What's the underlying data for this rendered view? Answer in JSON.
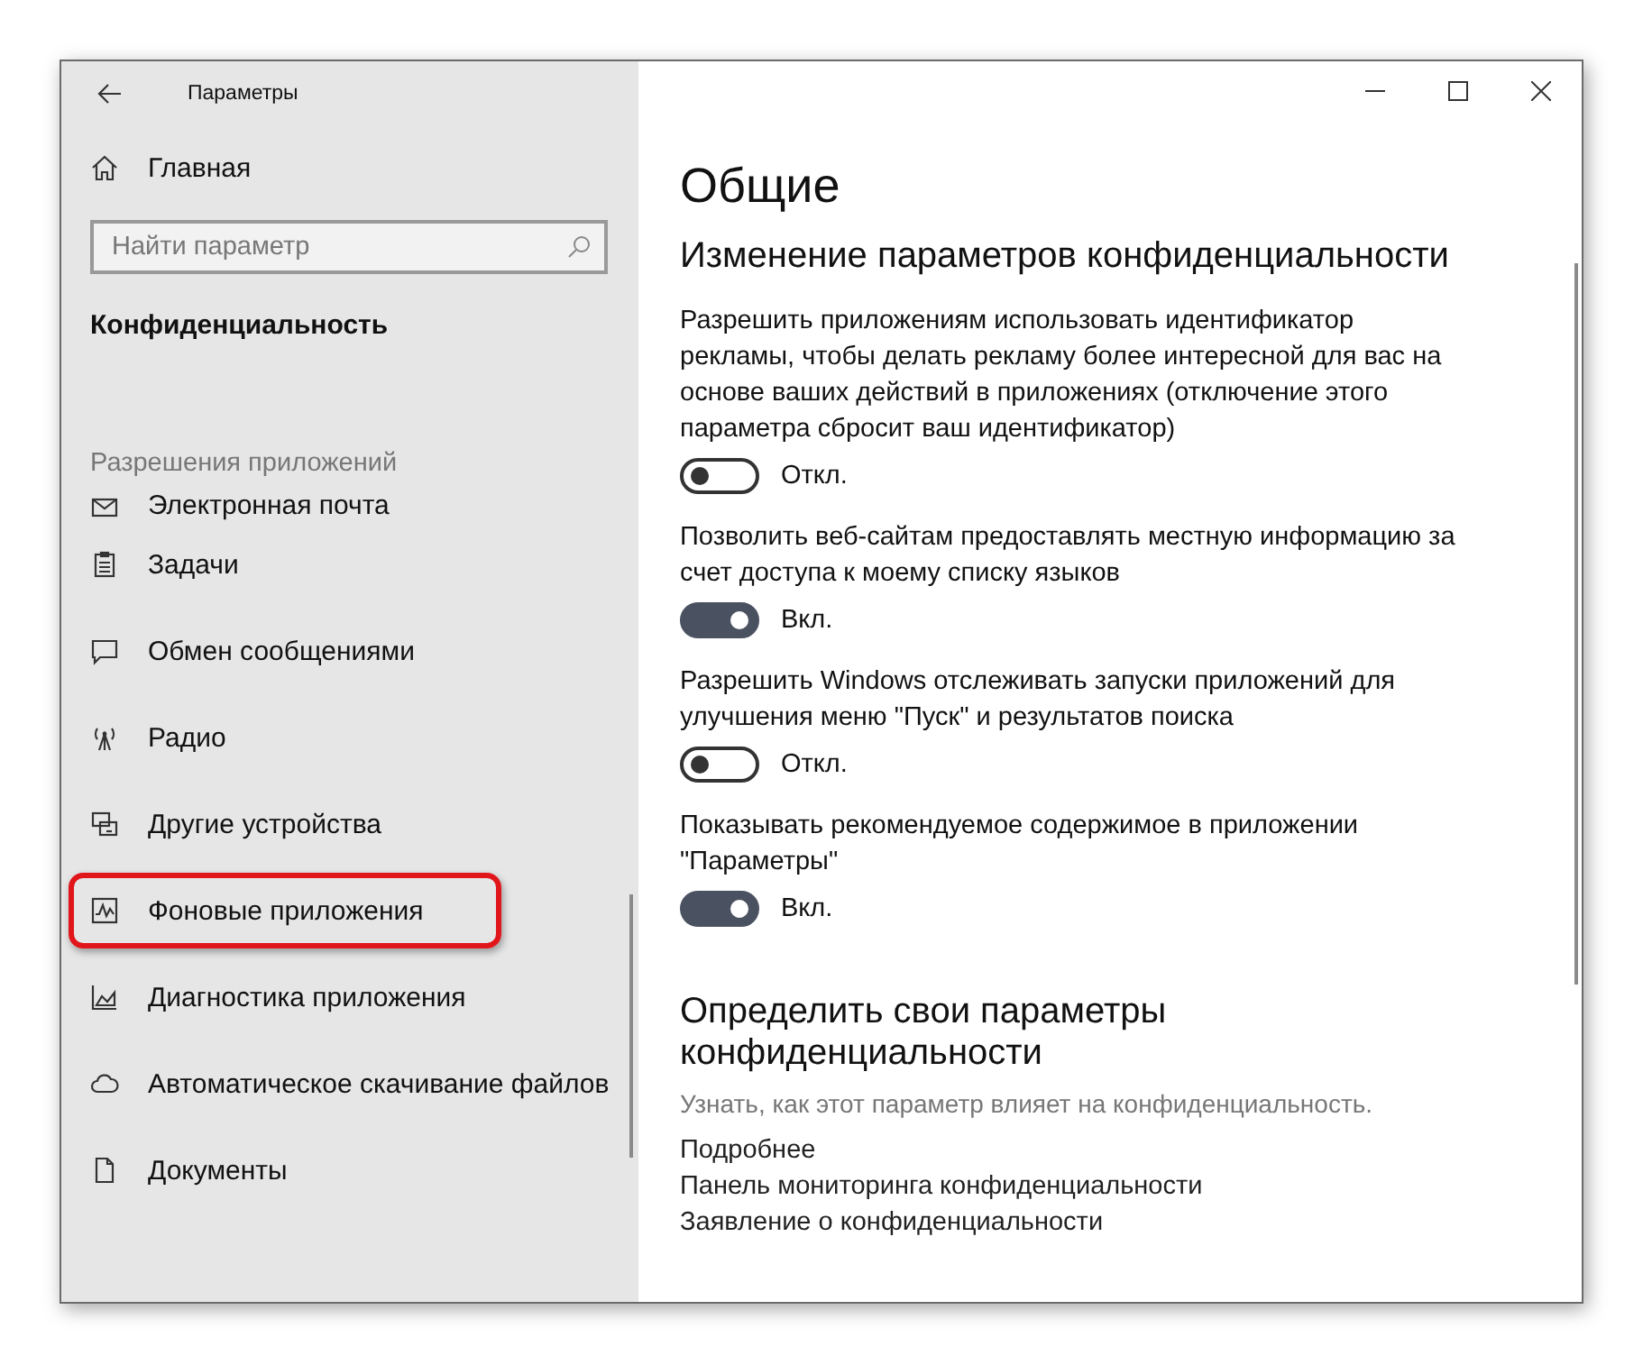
{
  "window": {
    "title": "Параметры"
  },
  "sidebar": {
    "home": "Главная",
    "search": {
      "placeholder": "Найти параметр"
    },
    "section": "Конфиденциальность",
    "group": "Разрешения приложений",
    "items": [
      {
        "label": "Электронная почта",
        "kind": "mail",
        "highlighted": false
      },
      {
        "label": "Задачи",
        "kind": "tasks",
        "highlighted": false
      },
      {
        "label": "Обмен сообщениями",
        "kind": "chat",
        "highlighted": false
      },
      {
        "label": "Радио",
        "kind": "radio",
        "highlighted": false
      },
      {
        "label": "Другие устройства",
        "kind": "devices",
        "highlighted": false
      },
      {
        "label": "Фоновые приложения",
        "kind": "background",
        "highlighted": true
      },
      {
        "label": "Диагностика приложения",
        "kind": "diagnostics",
        "highlighted": false
      },
      {
        "label": "Автоматическое скачивание файлов",
        "kind": "cloud",
        "highlighted": false
      },
      {
        "label": "Документы",
        "kind": "document",
        "highlighted": false
      }
    ]
  },
  "content": {
    "title": "Общие",
    "heading": "Изменение параметров конфиденциальности",
    "settings": [
      {
        "description": "Разрешить приложениям использовать идентификатор рекламы, чтобы делать рекламу более интересной для вас на основе ваших действий в приложениях (отключение этого параметра сбросит ваш идентификатор)",
        "on": false,
        "state_label": "Откл."
      },
      {
        "description": "Позволить веб-сайтам предоставлять местную информацию за счет доступа к моему списку языков",
        "on": true,
        "state_label": "Вкл."
      },
      {
        "description": "Разрешить Windows отслеживать запуски приложений для улучшения меню \"Пуск\" и результатов поиска",
        "on": false,
        "state_label": "Откл."
      },
      {
        "description": "Показывать рекомендуемое содержимое в приложении \"Параметры\"",
        "on": true,
        "state_label": "Вкл."
      }
    ],
    "section2": {
      "heading": "Определить свои параметры конфиденциальности",
      "note": "Узнать, как этот параметр влияет на конфиденциальность.",
      "links": [
        "Подробнее",
        "Панель мониторинга конфиденциальности",
        "Заявление о конфиденциальности"
      ]
    }
  }
}
